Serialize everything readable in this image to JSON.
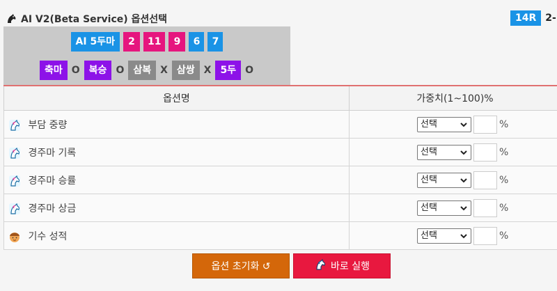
{
  "header": {
    "title": "AI V2(Beta Service) 옵션선택"
  },
  "race": {
    "badge": "14R",
    "date": "2-"
  },
  "selection": {
    "main_label": "AI 5두마",
    "numbers": [
      "2",
      "11",
      "9",
      "6",
      "7"
    ],
    "bets": [
      {
        "label": "축마",
        "mark": "O",
        "color": "purple"
      },
      {
        "label": "복승",
        "mark": "O",
        "color": "purple"
      },
      {
        "label": "삼복",
        "mark": "X",
        "color": "gray"
      },
      {
        "label": "삼쌍",
        "mark": "X",
        "color": "gray"
      },
      {
        "label": "5두",
        "mark": "O",
        "color": "purple"
      }
    ]
  },
  "table": {
    "headers": [
      "옵션명",
      "가중치(1~100)%"
    ],
    "rows": [
      {
        "name": "부담 중량",
        "icon": "horse-icon",
        "select": "선택",
        "pct": "%"
      },
      {
        "name": "경주마 기록",
        "icon": "horse-icon",
        "select": "선택",
        "pct": "%"
      },
      {
        "name": "경주마 승률",
        "icon": "horse-icon",
        "select": "선택",
        "pct": "%"
      },
      {
        "name": "경주마 상금",
        "icon": "horse-icon",
        "select": "선택",
        "pct": "%"
      },
      {
        "name": "기수 성적",
        "icon": "jockey-icon",
        "select": "선택",
        "pct": "%"
      }
    ]
  },
  "buttons": {
    "reset": "옵션 초기화 ↺",
    "run": "바로 실행"
  },
  "colors": {
    "blue": "#1a93e6",
    "pink": "#e6157e",
    "purple": "#8d12e8",
    "gray": "#8a8a8a",
    "orange": "#d4670a",
    "red": "#e8183f"
  }
}
